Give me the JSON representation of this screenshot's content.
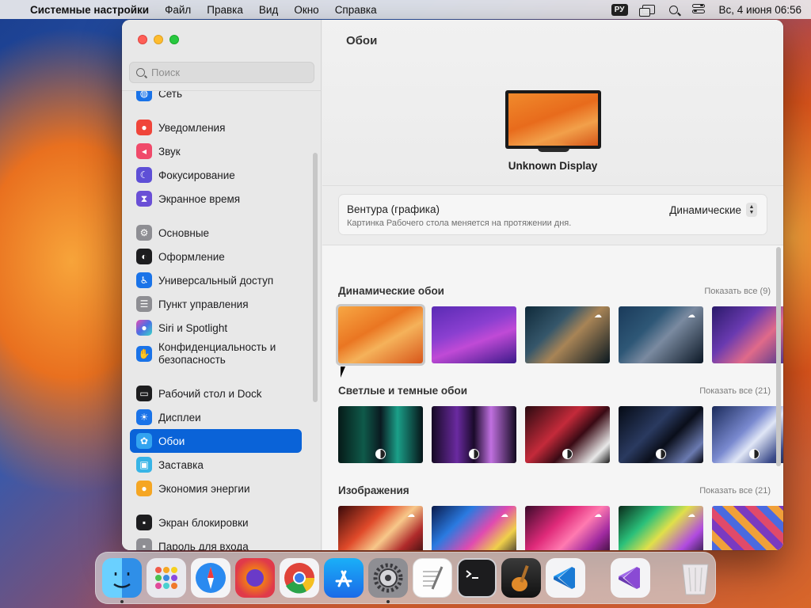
{
  "menubar": {
    "apple_icon": "apple-icon",
    "app_name": "Системные настройки",
    "menus": [
      "Файл",
      "Правка",
      "Вид",
      "Окно",
      "Справка"
    ],
    "keyboard_layout": "РУ",
    "clock": "Вс, 4 июня  06:56"
  },
  "sidebar": {
    "search_placeholder": "Поиск",
    "items": [
      {
        "label": "Сеть",
        "icon": "globe-icon",
        "color": "#1a73e8"
      },
      {
        "label": "Уведомления",
        "icon": "bell-icon",
        "color": "#f0453a"
      },
      {
        "label": "Звук",
        "icon": "speaker-icon",
        "color": "#f04a6a"
      },
      {
        "label": "Фокусирование",
        "icon": "moon-icon",
        "color": "#5e4fd6"
      },
      {
        "label": "Экранное время",
        "icon": "hourglass-icon",
        "color": "#6a4fd6"
      },
      {
        "label": "Основные",
        "icon": "gear-icon",
        "color": "#8e8e93"
      },
      {
        "label": "Оформление",
        "icon": "appearance-icon",
        "color": "#1d1d1f"
      },
      {
        "label": "Универсальный доступ",
        "icon": "accessibility-icon",
        "color": "#1a73e8"
      },
      {
        "label": "Пункт управления",
        "icon": "toggles-icon",
        "color": "#8e8e93"
      },
      {
        "label": "Siri и Spotlight",
        "icon": "siri-icon",
        "color": "#b03bd6"
      },
      {
        "label": "Конфиденциальность и безопасность",
        "icon": "hand-icon",
        "color": "#1a73e8"
      },
      {
        "label": "Рабочий стол и Dock",
        "icon": "dock-icon",
        "color": "#1d1d1f"
      },
      {
        "label": "Дисплеи",
        "icon": "sun-icon",
        "color": "#1a73e8"
      },
      {
        "label": "Обои",
        "icon": "flower-icon",
        "color": "#33a4f0"
      },
      {
        "label": "Заставка",
        "icon": "screensaver-icon",
        "color": "#37b4e6"
      },
      {
        "label": "Экономия энергии",
        "icon": "bulb-icon",
        "color": "#f5a623"
      },
      {
        "label": "Экран блокировки",
        "icon": "lock-icon",
        "color": "#1d1d1f"
      },
      {
        "label": "Пароль для входа",
        "icon": "lock-icon",
        "color": "#8e8e93"
      }
    ]
  },
  "main": {
    "title": "Обои",
    "display_name": "Unknown Display",
    "current": {
      "name": "Вентура (графика)",
      "description": "Картинка Рабочего стола меняется на протяжении дня.",
      "mode": "Динамические"
    },
    "sections": [
      {
        "title": "Динамические обои",
        "show_all": "Показать все (9)"
      },
      {
        "title": "Светлые и темные обои",
        "show_all": "Показать все (21)"
      },
      {
        "title": "Изображения",
        "show_all": "Показать все (21)"
      }
    ]
  },
  "dock": {
    "apps": [
      "Finder",
      "Launchpad",
      "Safari",
      "Firefox",
      "Chrome",
      "App Store",
      "Системные настройки",
      "TextEdit",
      "Terminal",
      "GarageBand",
      "Visual Studio Code",
      "Visual Studio",
      "Корзина"
    ]
  }
}
